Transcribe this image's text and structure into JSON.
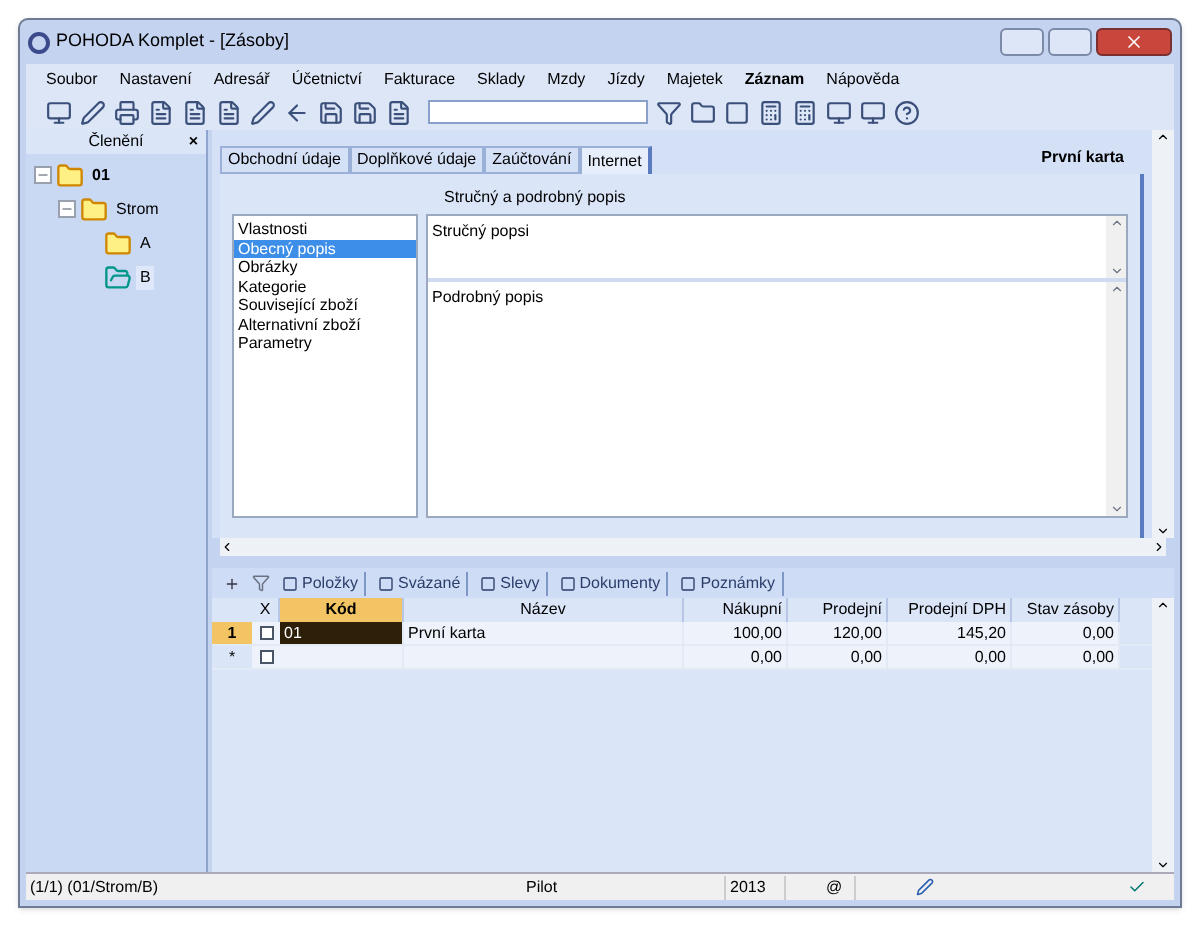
{
  "window": {
    "title": "POHODA Komplet - [Zásoby]"
  },
  "menu": [
    {
      "label": "Soubor",
      "bold": false
    },
    {
      "label": "Nastavení",
      "bold": false
    },
    {
      "label": "Adresář",
      "bold": false
    },
    {
      "label": "Účetnictví",
      "bold": false
    },
    {
      "label": "Fakturace",
      "bold": false
    },
    {
      "label": "Sklady",
      "bold": false
    },
    {
      "label": "Mzdy",
      "bold": false
    },
    {
      "label": "Jízdy",
      "bold": false
    },
    {
      "label": "Majetek",
      "bold": false
    },
    {
      "label": "Záznam",
      "bold": true
    },
    {
      "label": "Nápověda",
      "bold": false
    }
  ],
  "sidebar": {
    "title": "Členění",
    "close": "×",
    "tree": [
      {
        "label": "01",
        "selected": false,
        "children": [
          {
            "label": "Strom",
            "selected": false,
            "children": [
              {
                "label": "A",
                "selected": false
              },
              {
                "label": "B",
                "selected": true
              }
            ]
          }
        ]
      }
    ]
  },
  "tabs": [
    {
      "label": "Obchodní údaje",
      "selected": false
    },
    {
      "label": "Doplňkové údaje",
      "selected": false
    },
    {
      "label": "Zaúčtování",
      "selected": false
    },
    {
      "label": "Internet",
      "selected": true
    }
  ],
  "record_title": "První karta",
  "group_title": "Stručný a podrobný popis",
  "sections": [
    {
      "label": "Vlastnosti",
      "selected": false
    },
    {
      "label": "Obecný popis",
      "selected": true
    },
    {
      "label": "Obrázky",
      "selected": false
    },
    {
      "label": "Kategorie",
      "selected": false
    },
    {
      "label": "Související zboží",
      "selected": false
    },
    {
      "label": "Alternativní zboží",
      "selected": false
    },
    {
      "label": "Parametry",
      "selected": false
    }
  ],
  "short_description": "Stručný popsi",
  "long_description": "Podrobný popis",
  "bottom_tabs": [
    {
      "label": "Položky"
    },
    {
      "label": "Svázané"
    },
    {
      "label": "Slevy"
    },
    {
      "label": "Dokumenty"
    },
    {
      "label": "Poznámky"
    }
  ],
  "table": {
    "check_column": "X",
    "columns": [
      "Kód",
      "Název",
      "Nákupní",
      "Prodejní",
      "Prodejní DPH",
      "Stav zásoby"
    ],
    "rows": [
      {
        "marker": "1",
        "selected": true,
        "checked": false,
        "cells": [
          "01",
          "První karta",
          "100,00",
          "120,00",
          "145,20",
          "0,00"
        ]
      },
      {
        "marker": "*",
        "selected": false,
        "checked": false,
        "cells": [
          "",
          "",
          "0,00",
          "0,00",
          "0,00",
          "0,00"
        ]
      }
    ]
  },
  "status_bar": {
    "path": "(1/1) (01/Strom/B)",
    "user": "Pilot",
    "year": "2013",
    "at": "@"
  }
}
